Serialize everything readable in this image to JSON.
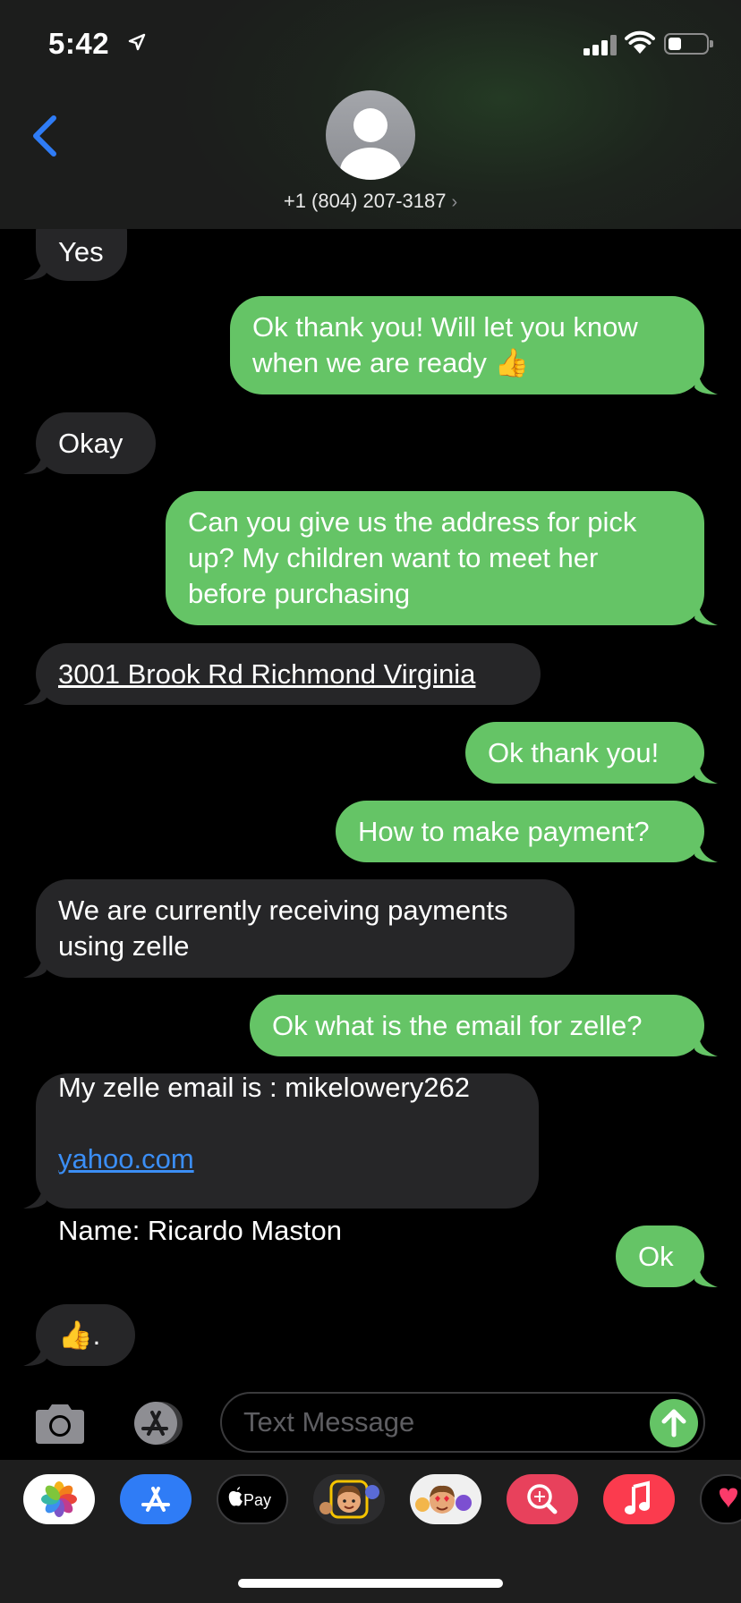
{
  "status_bar": {
    "time": "5:42"
  },
  "contact": {
    "number": "+1 (804) 207-3187",
    "chevron": "›"
  },
  "messages": [
    {
      "side": "in",
      "text": "Yes"
    },
    {
      "side": "out",
      "text": "Ok thank you! Will let you know\nwhen we are ready 👍"
    },
    {
      "side": "in",
      "text": "Okay"
    },
    {
      "side": "out",
      "text": "Can you give us the address for pick\nup? My children want to meet her\nbefore purchasing"
    },
    {
      "side": "in",
      "text": "3001 Brook Rd Richmond Virginia"
    },
    {
      "side": "out",
      "text": "Ok thank you!"
    },
    {
      "side": "out",
      "text": "How to make payment?"
    },
    {
      "side": "in",
      "text": "We are currently receiving payments\nusing zelle"
    },
    {
      "side": "out",
      "text": "Ok what is the email for zelle?"
    },
    {
      "side": "in",
      "text_line1": "My zelle email is : mikelowery262",
      "text_link": "yahoo.com",
      "text_line3": "Name: Ricardo Maston"
    },
    {
      "side": "out",
      "text": "Ok"
    },
    {
      "side": "in",
      "text": "👍."
    }
  ],
  "composer": {
    "placeholder": "Text Message"
  },
  "app_drawer": {
    "apps": [
      {
        "name": "Photos",
        "icon": "photos-icon"
      },
      {
        "name": "App Store",
        "icon": "app-store-icon"
      },
      {
        "name": "Apple Pay",
        "label": "Pay",
        "icon": "apple-pay-icon"
      },
      {
        "name": "Memoji",
        "icon": "memoji-icon"
      },
      {
        "name": "Memoji Stickers",
        "icon": "memoji-stickers-icon"
      },
      {
        "name": "Images Search",
        "icon": "images-search-icon"
      },
      {
        "name": "Music",
        "icon": "music-icon"
      },
      {
        "name": "Digital Touch",
        "icon": "digital-touch-icon"
      }
    ]
  },
  "colors": {
    "outgoing": "#65c466",
    "incoming": "#262628",
    "accent": "#3b8ef5"
  }
}
